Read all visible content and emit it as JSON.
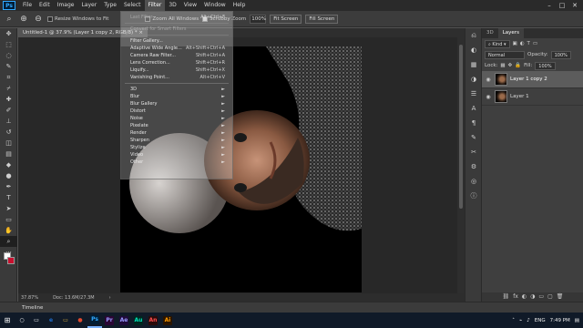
{
  "menubar": {
    "logo": "Ps",
    "items": [
      "File",
      "Edit",
      "Image",
      "Layer",
      "Type",
      "Select",
      "Filter",
      "3D",
      "View",
      "Window",
      "Help"
    ],
    "active_item": "Filter",
    "win_controls": [
      "–",
      "□",
      "✕"
    ]
  },
  "options": {
    "resize_windows": "Resize Windows to Fit",
    "zoom_all": "Zoom All Windows",
    "scrubby_zoom": "Scrubby Zoom",
    "zoom_value": "100%",
    "fit_screen": "Fit Screen",
    "fill_screen": "Fill Screen"
  },
  "document": {
    "tab_title": "Untitled-1 @ 37.9% (Layer 1 copy 2, RGB/8) *",
    "zoom": "37.87%",
    "doc_info": "Doc: 13.6M/27.3M"
  },
  "filter_menu": [
    {
      "label": "Last Filter",
      "shortcut": "Alt+Ctrl+F",
      "dim": true
    },
    {
      "sep": true
    },
    {
      "label": "Convert for Smart Filters",
      "shortcut": "",
      "dim": true
    },
    {
      "sep": true
    },
    {
      "label": "Filter Gallery...",
      "shortcut": "",
      "dim": false
    },
    {
      "label": "Adaptive Wide Angle...",
      "shortcut": "Alt+Shift+Ctrl+A",
      "dim": false
    },
    {
      "label": "Camera Raw Filter...",
      "shortcut": "Shift+Ctrl+A",
      "dim": false
    },
    {
      "label": "Lens Correction...",
      "shortcut": "Shift+Ctrl+R",
      "dim": false
    },
    {
      "label": "Liquify...",
      "shortcut": "Shift+Ctrl+X",
      "dim": false
    },
    {
      "label": "Vanishing Point...",
      "shortcut": "Alt+Ctrl+V",
      "dim": false
    },
    {
      "sep": true
    },
    {
      "label": "3D",
      "shortcut": "►",
      "dim": false
    },
    {
      "label": "Blur",
      "shortcut": "►",
      "dim": false
    },
    {
      "label": "Blur Gallery",
      "shortcut": "►",
      "dim": false
    },
    {
      "label": "Distort",
      "shortcut": "►",
      "dim": false
    },
    {
      "label": "Noise",
      "shortcut": "►",
      "dim": false
    },
    {
      "label": "Pixelate",
      "shortcut": "►",
      "dim": false
    },
    {
      "label": "Render",
      "shortcut": "►",
      "dim": false
    },
    {
      "label": "Sharpen",
      "shortcut": "►",
      "dim": false
    },
    {
      "label": "Stylize",
      "shortcut": "►",
      "dim": false
    },
    {
      "label": "Video",
      "shortcut": "►",
      "dim": false
    },
    {
      "label": "Other",
      "shortcut": "►",
      "dim": false
    }
  ],
  "layers_panel": {
    "tabs": [
      "3D",
      "Layers"
    ],
    "active_tab": "Layers",
    "kind_filter": "Kind",
    "blend_mode": "Normal",
    "opacity_label": "Opacity:",
    "opacity_value": "100%",
    "lock_label": "Lock:",
    "fill_label": "Fill:",
    "fill_value": "100%",
    "layers": [
      {
        "name": "Layer 1 copy 2",
        "selected": true
      },
      {
        "name": "Layer 1",
        "selected": false
      }
    ],
    "bottom_icons": [
      "⛓",
      "fx",
      "◐",
      "◑",
      "▭",
      "▢",
      "🗑"
    ]
  },
  "timeline": {
    "label": "Timeline"
  },
  "taskbar": {
    "apps": [
      {
        "label": "e",
        "color": "#1f6fd1",
        "running": false
      },
      {
        "label": "▭",
        "color": "#e0b13c",
        "running": false
      },
      {
        "label": "●",
        "color": "#e24a2f",
        "running": false
      },
      {
        "label": "Ps",
        "color": "#31a8ff",
        "running": true
      },
      {
        "label": "Pr",
        "color": "#9999ff",
        "running": false
      },
      {
        "label": "Ae",
        "color": "#9999ff",
        "running": false
      },
      {
        "label": "Au",
        "color": "#00e4bb",
        "running": false
      },
      {
        "label": "An",
        "color": "#ff4f4f",
        "running": false
      },
      {
        "label": "Ai",
        "color": "#ff9a00",
        "running": false
      }
    ],
    "language": "ENG",
    "time": "7:49 PM"
  }
}
